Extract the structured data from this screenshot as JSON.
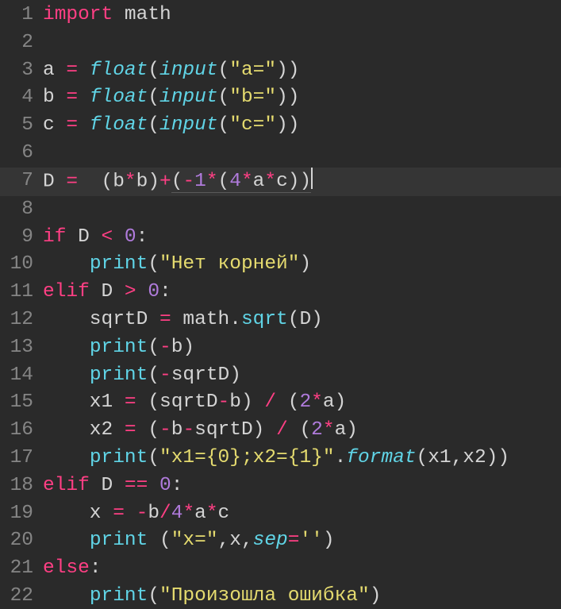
{
  "lines": [
    {
      "n": "1",
      "current": false,
      "tokens": [
        {
          "t": "import",
          "c": "kw"
        },
        {
          "t": " ",
          "c": "def"
        },
        {
          "t": "math",
          "c": "def"
        }
      ]
    },
    {
      "n": "2",
      "current": false,
      "tokens": []
    },
    {
      "n": "3",
      "current": false,
      "tokens": [
        {
          "t": "a ",
          "c": "def"
        },
        {
          "t": "=",
          "c": "op"
        },
        {
          "t": " ",
          "c": "def"
        },
        {
          "t": "float",
          "c": "fnit"
        },
        {
          "t": "(",
          "c": "punct"
        },
        {
          "t": "input",
          "c": "fnit"
        },
        {
          "t": "(",
          "c": "punct"
        },
        {
          "t": "\"a=\"",
          "c": "str"
        },
        {
          "t": "))",
          "c": "punct"
        }
      ]
    },
    {
      "n": "4",
      "current": false,
      "tokens": [
        {
          "t": "b ",
          "c": "def"
        },
        {
          "t": "=",
          "c": "op"
        },
        {
          "t": " ",
          "c": "def"
        },
        {
          "t": "float",
          "c": "fnit"
        },
        {
          "t": "(",
          "c": "punct"
        },
        {
          "t": "input",
          "c": "fnit"
        },
        {
          "t": "(",
          "c": "punct"
        },
        {
          "t": "\"b=\"",
          "c": "str"
        },
        {
          "t": "))",
          "c": "punct"
        }
      ]
    },
    {
      "n": "5",
      "current": false,
      "tokens": [
        {
          "t": "c ",
          "c": "def"
        },
        {
          "t": "=",
          "c": "op"
        },
        {
          "t": " ",
          "c": "def"
        },
        {
          "t": "float",
          "c": "fnit"
        },
        {
          "t": "(",
          "c": "punct"
        },
        {
          "t": "input",
          "c": "fnit"
        },
        {
          "t": "(",
          "c": "punct"
        },
        {
          "t": "\"c=\"",
          "c": "str"
        },
        {
          "t": "))",
          "c": "punct"
        }
      ]
    },
    {
      "n": "6",
      "current": false,
      "tokens": []
    },
    {
      "n": "7",
      "current": true,
      "tokens": [
        {
          "t": "D ",
          "c": "def"
        },
        {
          "t": "=",
          "c": "op"
        },
        {
          "t": "  (b",
          "c": "def"
        },
        {
          "t": "*",
          "c": "op"
        },
        {
          "t": "b)",
          "c": "def"
        },
        {
          "t": "+",
          "c": "op"
        },
        {
          "t": "(",
          "c": "def",
          "u": true
        },
        {
          "t": "-",
          "c": "op",
          "u": true
        },
        {
          "t": "1",
          "c": "num",
          "u": true
        },
        {
          "t": "*",
          "c": "op",
          "u": true
        },
        {
          "t": "(",
          "c": "def",
          "u": true
        },
        {
          "t": "4",
          "c": "num",
          "u": true
        },
        {
          "t": "*",
          "c": "op",
          "u": true
        },
        {
          "t": "a",
          "c": "def",
          "u": true
        },
        {
          "t": "*",
          "c": "op",
          "u": true
        },
        {
          "t": "c))",
          "c": "def",
          "u": true
        },
        {
          "t": "",
          "c": "def",
          "cursor": true
        }
      ]
    },
    {
      "n": "8",
      "current": false,
      "tokens": []
    },
    {
      "n": "9",
      "current": false,
      "tokens": [
        {
          "t": "if",
          "c": "kw"
        },
        {
          "t": " D ",
          "c": "def"
        },
        {
          "t": "<",
          "c": "op"
        },
        {
          "t": " ",
          "c": "def"
        },
        {
          "t": "0",
          "c": "num"
        },
        {
          "t": ":",
          "c": "punct"
        }
      ]
    },
    {
      "n": "10",
      "current": false,
      "tokens": [
        {
          "t": "    ",
          "c": "def"
        },
        {
          "t": "print",
          "c": "fn"
        },
        {
          "t": "(",
          "c": "punct"
        },
        {
          "t": "\"Нет корней\"",
          "c": "str"
        },
        {
          "t": ")",
          "c": "punct"
        }
      ]
    },
    {
      "n": "11",
      "current": false,
      "tokens": [
        {
          "t": "elif",
          "c": "kw"
        },
        {
          "t": " D ",
          "c": "def"
        },
        {
          "t": ">",
          "c": "op"
        },
        {
          "t": " ",
          "c": "def"
        },
        {
          "t": "0",
          "c": "num"
        },
        {
          "t": ":",
          "c": "punct"
        }
      ]
    },
    {
      "n": "12",
      "current": false,
      "tokens": [
        {
          "t": "    sqrtD ",
          "c": "def"
        },
        {
          "t": "=",
          "c": "op"
        },
        {
          "t": " math.",
          "c": "def"
        },
        {
          "t": "sqrt",
          "c": "fn"
        },
        {
          "t": "(D)",
          "c": "punct"
        }
      ]
    },
    {
      "n": "13",
      "current": false,
      "tokens": [
        {
          "t": "    ",
          "c": "def"
        },
        {
          "t": "print",
          "c": "fn"
        },
        {
          "t": "(",
          "c": "punct"
        },
        {
          "t": "-",
          "c": "op"
        },
        {
          "t": "b)",
          "c": "def"
        }
      ]
    },
    {
      "n": "14",
      "current": false,
      "tokens": [
        {
          "t": "    ",
          "c": "def"
        },
        {
          "t": "print",
          "c": "fn"
        },
        {
          "t": "(",
          "c": "punct"
        },
        {
          "t": "-",
          "c": "op"
        },
        {
          "t": "sqrtD)",
          "c": "def"
        }
      ]
    },
    {
      "n": "15",
      "current": false,
      "tokens": [
        {
          "t": "    x1 ",
          "c": "def"
        },
        {
          "t": "=",
          "c": "op"
        },
        {
          "t": " (sqrtD",
          "c": "def"
        },
        {
          "t": "-",
          "c": "op"
        },
        {
          "t": "b) ",
          "c": "def"
        },
        {
          "t": "/",
          "c": "op"
        },
        {
          "t": " (",
          "c": "def"
        },
        {
          "t": "2",
          "c": "num"
        },
        {
          "t": "*",
          "c": "op"
        },
        {
          "t": "a)",
          "c": "def"
        }
      ]
    },
    {
      "n": "16",
      "current": false,
      "tokens": [
        {
          "t": "    x2 ",
          "c": "def"
        },
        {
          "t": "=",
          "c": "op"
        },
        {
          "t": " (",
          "c": "def"
        },
        {
          "t": "-",
          "c": "op"
        },
        {
          "t": "b",
          "c": "def"
        },
        {
          "t": "-",
          "c": "op"
        },
        {
          "t": "sqrtD) ",
          "c": "def"
        },
        {
          "t": "/",
          "c": "op"
        },
        {
          "t": " (",
          "c": "def"
        },
        {
          "t": "2",
          "c": "num"
        },
        {
          "t": "*",
          "c": "op"
        },
        {
          "t": "a)",
          "c": "def"
        }
      ]
    },
    {
      "n": "17",
      "current": false,
      "tokens": [
        {
          "t": "    ",
          "c": "def"
        },
        {
          "t": "print",
          "c": "fn"
        },
        {
          "t": "(",
          "c": "punct"
        },
        {
          "t": "\"x1={0};x2={1}\"",
          "c": "str"
        },
        {
          "t": ".",
          "c": "punct"
        },
        {
          "t": "format",
          "c": "fnit"
        },
        {
          "t": "(x1,x2))",
          "c": "punct"
        }
      ]
    },
    {
      "n": "18",
      "current": false,
      "tokens": [
        {
          "t": "elif",
          "c": "kw"
        },
        {
          "t": " D ",
          "c": "def"
        },
        {
          "t": "==",
          "c": "op"
        },
        {
          "t": " ",
          "c": "def"
        },
        {
          "t": "0",
          "c": "num"
        },
        {
          "t": ":",
          "c": "punct"
        }
      ]
    },
    {
      "n": "19",
      "current": false,
      "tokens": [
        {
          "t": "    x ",
          "c": "def"
        },
        {
          "t": "=",
          "c": "op"
        },
        {
          "t": " ",
          "c": "def"
        },
        {
          "t": "-",
          "c": "op"
        },
        {
          "t": "b",
          "c": "def"
        },
        {
          "t": "/",
          "c": "op"
        },
        {
          "t": "4",
          "c": "num"
        },
        {
          "t": "*",
          "c": "op"
        },
        {
          "t": "a",
          "c": "def"
        },
        {
          "t": "*",
          "c": "op"
        },
        {
          "t": "c",
          "c": "def"
        }
      ]
    },
    {
      "n": "20",
      "current": false,
      "tokens": [
        {
          "t": "    ",
          "c": "def"
        },
        {
          "t": "print",
          "c": "fn"
        },
        {
          "t": " (",
          "c": "punct"
        },
        {
          "t": "\"x=\"",
          "c": "str"
        },
        {
          "t": ",x,",
          "c": "punct"
        },
        {
          "t": "sep",
          "c": "fnit"
        },
        {
          "t": "=",
          "c": "op"
        },
        {
          "t": "''",
          "c": "str"
        },
        {
          "t": ")",
          "c": "punct"
        }
      ]
    },
    {
      "n": "21",
      "current": false,
      "tokens": [
        {
          "t": "else",
          "c": "kw"
        },
        {
          "t": ":",
          "c": "punct"
        }
      ]
    },
    {
      "n": "22",
      "current": false,
      "tokens": [
        {
          "t": "    ",
          "c": "def"
        },
        {
          "t": "print",
          "c": "fn"
        },
        {
          "t": "(",
          "c": "punct"
        },
        {
          "t": "\"Произошла ошибка\"",
          "c": "str"
        },
        {
          "t": ")",
          "c": "punct"
        }
      ]
    }
  ]
}
